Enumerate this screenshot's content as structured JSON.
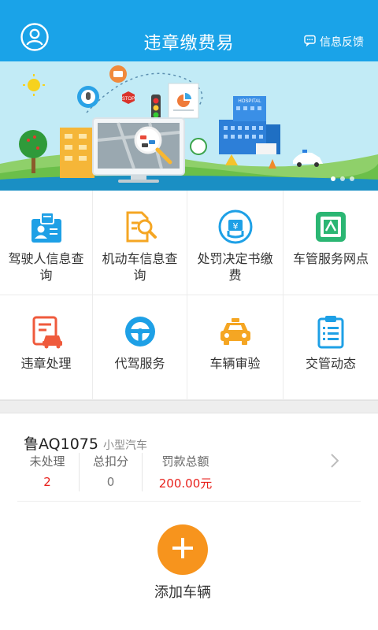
{
  "header": {
    "title": "违章缴费易",
    "feedback": "信息反馈",
    "avatar_icon": "user-circle-icon",
    "feedback_icon": "chat-bubble-icon"
  },
  "banner": {
    "sign_text": "STOP",
    "building_text": "HOSPITAL",
    "slide_count": 3,
    "active_slide": 1
  },
  "grid": [
    {
      "label": "驾驶人信息查询",
      "icon": "driver-id-card-icon"
    },
    {
      "label": "机动车信息查询",
      "icon": "document-search-icon"
    },
    {
      "label": "处罚决定书缴费",
      "icon": "yuan-payment-icon"
    },
    {
      "label": "车管服务网点",
      "icon": "service-outlet-icon"
    },
    {
      "label": "违章处理",
      "icon": "violation-car-icon"
    },
    {
      "label": "代驾服务",
      "icon": "steering-wheel-icon"
    },
    {
      "label": "车辆审验",
      "icon": "taxi-inspection-icon"
    },
    {
      "label": "交管动态",
      "icon": "clipboard-news-icon"
    }
  ],
  "vehicle": {
    "plate": "鲁AQ1075",
    "type": "小型汽车",
    "unprocessed_label": "未处理",
    "unprocessed_value": "2",
    "points_label": "总扣分",
    "points_value": "0",
    "fine_label": "罚款总额",
    "fine_value": "200.00元"
  },
  "add": {
    "label": "添加车辆",
    "icon": "plus-icon"
  },
  "colors": {
    "header": "#1aa3e8",
    "accent_orange": "#f7941d",
    "alert_red": "#e8211c"
  }
}
